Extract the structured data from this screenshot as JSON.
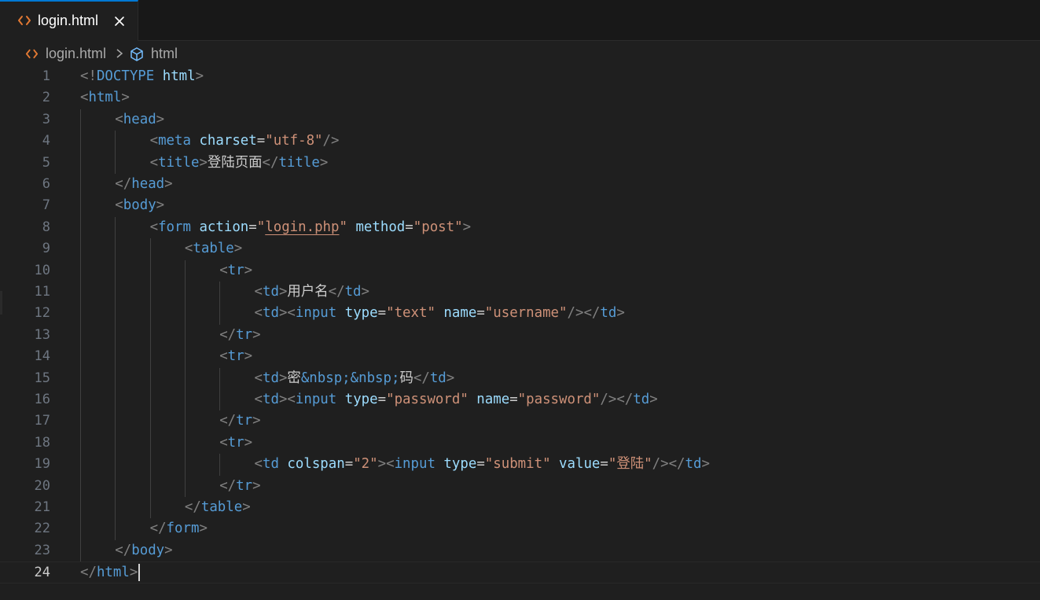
{
  "tab": {
    "label": "login.html",
    "icon": "html-file-icon",
    "active": true
  },
  "breadcrumb": {
    "file": "login.html",
    "separator": "chevron-right-icon",
    "symbol": "html",
    "symbol_icon": "cube-icon"
  },
  "colors": {
    "background": "#1f1f1f",
    "tag": "#569cd6",
    "attribute": "#9cdcfe",
    "string": "#ce9178",
    "punctuation": "#808080",
    "tab_accent": "#0078d4",
    "file_icon": "#e37933"
  },
  "editor": {
    "current_line": 24,
    "lines": [
      {
        "n": "1",
        "indent": 0,
        "tokens": [
          [
            "p",
            "<!"
          ],
          [
            "doc",
            "DOCTYPE"
          ],
          [
            "text",
            " "
          ],
          [
            "attr",
            "html"
          ],
          [
            "p",
            ">"
          ]
        ]
      },
      {
        "n": "2",
        "indent": 0,
        "tokens": [
          [
            "p",
            "<"
          ],
          [
            "tag",
            "html"
          ],
          [
            "p",
            ">"
          ]
        ]
      },
      {
        "n": "3",
        "indent": 1,
        "tokens": [
          [
            "p",
            "<"
          ],
          [
            "tag",
            "head"
          ],
          [
            "p",
            ">"
          ]
        ]
      },
      {
        "n": "4",
        "indent": 2,
        "tokens": [
          [
            "p",
            "<"
          ],
          [
            "tag",
            "meta"
          ],
          [
            "text",
            " "
          ],
          [
            "attr",
            "charset"
          ],
          [
            "text",
            "="
          ],
          [
            "str",
            "\"utf-8\""
          ],
          [
            "p",
            "/>"
          ]
        ]
      },
      {
        "n": "5",
        "indent": 2,
        "tokens": [
          [
            "p",
            "<"
          ],
          [
            "tag",
            "title"
          ],
          [
            "p",
            ">"
          ],
          [
            "text",
            "登陆页面"
          ],
          [
            "p",
            "</"
          ],
          [
            "tag",
            "title"
          ],
          [
            "p",
            ">"
          ]
        ]
      },
      {
        "n": "6",
        "indent": 1,
        "tokens": [
          [
            "p",
            "</"
          ],
          [
            "tag",
            "head"
          ],
          [
            "p",
            ">"
          ]
        ]
      },
      {
        "n": "7",
        "indent": 1,
        "tokens": [
          [
            "p",
            "<"
          ],
          [
            "tag",
            "body"
          ],
          [
            "p",
            ">"
          ]
        ]
      },
      {
        "n": "8",
        "indent": 2,
        "tokens": [
          [
            "p",
            "<"
          ],
          [
            "tag",
            "form"
          ],
          [
            "text",
            " "
          ],
          [
            "attr",
            "action"
          ],
          [
            "text",
            "="
          ],
          [
            "str",
            "\""
          ],
          [
            "link",
            "login.php"
          ],
          [
            "str",
            "\""
          ],
          [
            "text",
            " "
          ],
          [
            "attr",
            "method"
          ],
          [
            "text",
            "="
          ],
          [
            "str",
            "\"post\""
          ],
          [
            "p",
            ">"
          ]
        ]
      },
      {
        "n": "9",
        "indent": 3,
        "tokens": [
          [
            "p",
            "<"
          ],
          [
            "tag",
            "table"
          ],
          [
            "p",
            ">"
          ]
        ]
      },
      {
        "n": "10",
        "indent": 4,
        "tokens": [
          [
            "p",
            "<"
          ],
          [
            "tag",
            "tr"
          ],
          [
            "p",
            ">"
          ]
        ]
      },
      {
        "n": "11",
        "indent": 5,
        "tokens": [
          [
            "p",
            "<"
          ],
          [
            "tag",
            "td"
          ],
          [
            "p",
            ">"
          ],
          [
            "text",
            "用户名"
          ],
          [
            "p",
            "</"
          ],
          [
            "tag",
            "td"
          ],
          [
            "p",
            ">"
          ]
        ]
      },
      {
        "n": "12",
        "indent": 5,
        "tokens": [
          [
            "p",
            "<"
          ],
          [
            "tag",
            "td"
          ],
          [
            "p",
            "><"
          ],
          [
            "tag",
            "input"
          ],
          [
            "text",
            " "
          ],
          [
            "attr",
            "type"
          ],
          [
            "text",
            "="
          ],
          [
            "str",
            "\"text\""
          ],
          [
            "text",
            " "
          ],
          [
            "attr",
            "name"
          ],
          [
            "text",
            "="
          ],
          [
            "str",
            "\"username\""
          ],
          [
            "p",
            "/></"
          ],
          [
            "tag",
            "td"
          ],
          [
            "p",
            ">"
          ]
        ]
      },
      {
        "n": "13",
        "indent": 4,
        "tokens": [
          [
            "p",
            "</"
          ],
          [
            "tag",
            "tr"
          ],
          [
            "p",
            ">"
          ]
        ]
      },
      {
        "n": "14",
        "indent": 4,
        "tokens": [
          [
            "p",
            "<"
          ],
          [
            "tag",
            "tr"
          ],
          [
            "p",
            ">"
          ]
        ]
      },
      {
        "n": "15",
        "indent": 5,
        "tokens": [
          [
            "p",
            "<"
          ],
          [
            "tag",
            "td"
          ],
          [
            "p",
            ">"
          ],
          [
            "text",
            "密"
          ],
          [
            "ent",
            "&nbsp;&nbsp;"
          ],
          [
            "text",
            "码"
          ],
          [
            "p",
            "</"
          ],
          [
            "tag",
            "td"
          ],
          [
            "p",
            ">"
          ]
        ]
      },
      {
        "n": "16",
        "indent": 5,
        "tokens": [
          [
            "p",
            "<"
          ],
          [
            "tag",
            "td"
          ],
          [
            "p",
            "><"
          ],
          [
            "tag",
            "input"
          ],
          [
            "text",
            " "
          ],
          [
            "attr",
            "type"
          ],
          [
            "text",
            "="
          ],
          [
            "str",
            "\"password\""
          ],
          [
            "text",
            " "
          ],
          [
            "attr",
            "name"
          ],
          [
            "text",
            "="
          ],
          [
            "str",
            "\"password\""
          ],
          [
            "p",
            "/></"
          ],
          [
            "tag",
            "td"
          ],
          [
            "p",
            ">"
          ]
        ]
      },
      {
        "n": "17",
        "indent": 4,
        "tokens": [
          [
            "p",
            "</"
          ],
          [
            "tag",
            "tr"
          ],
          [
            "p",
            ">"
          ]
        ]
      },
      {
        "n": "18",
        "indent": 4,
        "tokens": [
          [
            "p",
            "<"
          ],
          [
            "tag",
            "tr"
          ],
          [
            "p",
            ">"
          ]
        ]
      },
      {
        "n": "19",
        "indent": 5,
        "tokens": [
          [
            "p",
            "<"
          ],
          [
            "tag",
            "td"
          ],
          [
            "text",
            " "
          ],
          [
            "attr",
            "colspan"
          ],
          [
            "text",
            "="
          ],
          [
            "str",
            "\"2\""
          ],
          [
            "p",
            "><"
          ],
          [
            "tag",
            "input"
          ],
          [
            "text",
            " "
          ],
          [
            "attr",
            "type"
          ],
          [
            "text",
            "="
          ],
          [
            "str",
            "\"submit\""
          ],
          [
            "text",
            " "
          ],
          [
            "attr",
            "value"
          ],
          [
            "text",
            "="
          ],
          [
            "str",
            "\"登陆\""
          ],
          [
            "p",
            "/></"
          ],
          [
            "tag",
            "td"
          ],
          [
            "p",
            ">"
          ]
        ]
      },
      {
        "n": "20",
        "indent": 4,
        "tokens": [
          [
            "p",
            "</"
          ],
          [
            "tag",
            "tr"
          ],
          [
            "p",
            ">"
          ]
        ]
      },
      {
        "n": "21",
        "indent": 3,
        "tokens": [
          [
            "p",
            "</"
          ],
          [
            "tag",
            "table"
          ],
          [
            "p",
            ">"
          ]
        ]
      },
      {
        "n": "22",
        "indent": 2,
        "tokens": [
          [
            "p",
            "</"
          ],
          [
            "tag",
            "form"
          ],
          [
            "p",
            ">"
          ]
        ]
      },
      {
        "n": "23",
        "indent": 1,
        "tokens": [
          [
            "p",
            "</"
          ],
          [
            "tag",
            "body"
          ],
          [
            "p",
            ">"
          ]
        ]
      },
      {
        "n": "24",
        "indent": 0,
        "tokens": [
          [
            "p",
            "</"
          ],
          [
            "tag",
            "html"
          ],
          [
            "p",
            ">"
          ]
        ]
      }
    ]
  }
}
